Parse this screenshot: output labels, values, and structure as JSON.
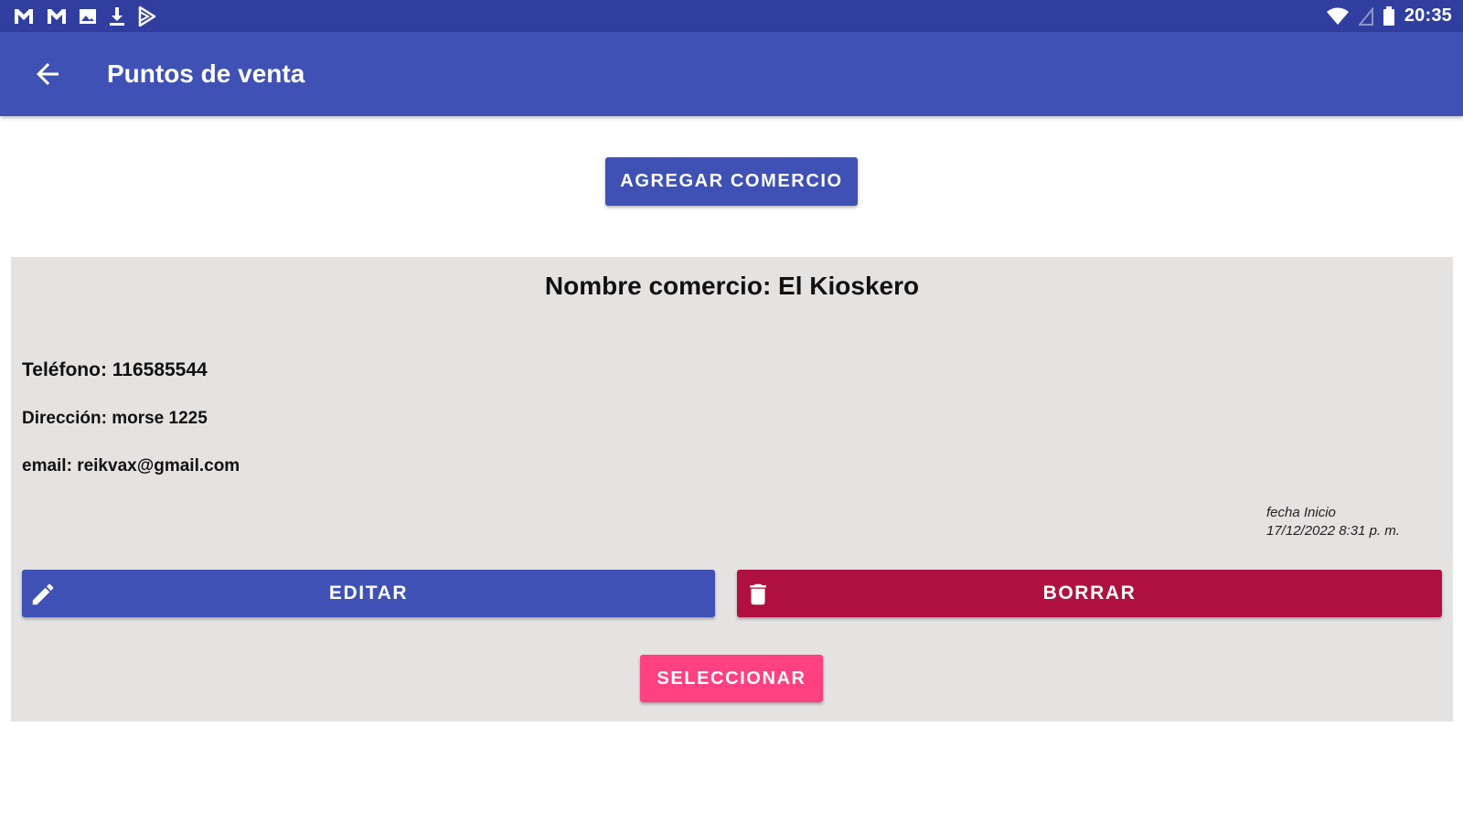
{
  "status_bar": {
    "time": "20:35",
    "left_icons": [
      "gmail-icon",
      "gmail-icon",
      "image-icon",
      "download-icon",
      "play-store-icon"
    ],
    "right_icons": [
      "wifi-icon",
      "no-signal-icon",
      "battery-icon"
    ]
  },
  "app_bar": {
    "title": "Puntos de venta",
    "back_icon": "arrow-back-icon"
  },
  "actions": {
    "add_label": "AGREGAR COMERCIO"
  },
  "store_card": {
    "title": "Nombre comercio: El Kioskero",
    "phone": "Teléfono: 116585544",
    "address": "Dirección: morse 1225",
    "email": "email: reikvax@gmail.com",
    "date_label": "fecha Inicio",
    "date_value": "17/12/2022 8:31 p. m.",
    "edit_label": "EDITAR",
    "edit_icon": "pencil-icon",
    "delete_label": "BORRAR",
    "delete_icon": "trash-icon",
    "select_label": "SELECCIONAR"
  },
  "colors": {
    "status_bar": "#303f9f",
    "primary": "#3f51b5",
    "delete": "#b0103f",
    "accent": "#ff4081",
    "card_background": "#e5e2e2"
  }
}
